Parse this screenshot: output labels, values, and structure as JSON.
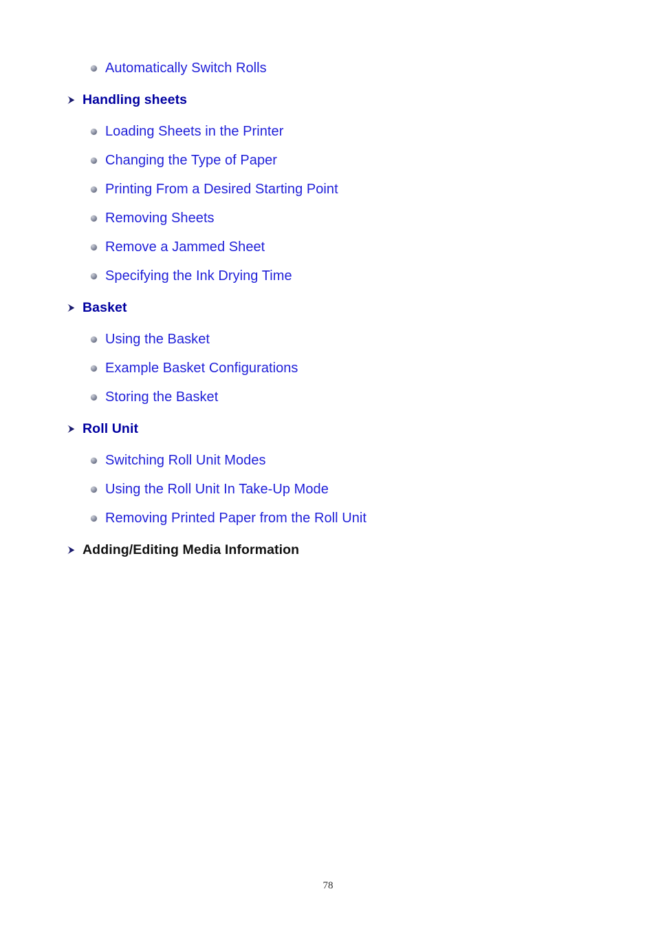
{
  "document": {
    "page_number": "78",
    "colors": {
      "link_text": "#1f1fd8",
      "heading_link": "#0000a0",
      "heading_plain": "#111111",
      "arrow_marker": "#1b1b6e",
      "bullet_marker": "#6e7489",
      "background": "#ffffff"
    }
  },
  "toc": {
    "rows": [
      {
        "kind": "item",
        "marker": "sphere-bullet-icon",
        "label": "Automatically Switch Rolls",
        "style": "link"
      },
      {
        "kind": "section",
        "marker": "arrow-right-icon",
        "label": "Handling sheets",
        "style": "link"
      },
      {
        "kind": "item",
        "marker": "sphere-bullet-icon",
        "label": "Loading Sheets in the Printer",
        "style": "link"
      },
      {
        "kind": "item",
        "marker": "sphere-bullet-icon",
        "label": "Changing the Type of Paper",
        "style": "link"
      },
      {
        "kind": "item",
        "marker": "sphere-bullet-icon",
        "label": "Printing From a Desired Starting Point",
        "style": "link"
      },
      {
        "kind": "item",
        "marker": "sphere-bullet-icon",
        "label": "Removing Sheets",
        "style": "link"
      },
      {
        "kind": "item",
        "marker": "sphere-bullet-icon",
        "label": "Remove a Jammed Sheet",
        "style": "link"
      },
      {
        "kind": "item",
        "marker": "sphere-bullet-icon",
        "label": "Specifying the Ink Drying Time",
        "style": "link"
      },
      {
        "kind": "section",
        "marker": "arrow-right-icon",
        "label": "Basket",
        "style": "link"
      },
      {
        "kind": "item",
        "marker": "sphere-bullet-icon",
        "label": "Using the Basket",
        "style": "link"
      },
      {
        "kind": "item",
        "marker": "sphere-bullet-icon",
        "label": "Example Basket Configurations",
        "style": "link"
      },
      {
        "kind": "item",
        "marker": "sphere-bullet-icon",
        "label": "Storing the Basket",
        "style": "link"
      },
      {
        "kind": "section",
        "marker": "arrow-right-icon",
        "label": "Roll Unit",
        "style": "link"
      },
      {
        "kind": "item",
        "marker": "sphere-bullet-icon",
        "label": "Switching Roll Unit Modes",
        "style": "link"
      },
      {
        "kind": "item",
        "marker": "sphere-bullet-icon",
        "label": "Using the Roll Unit In Take-Up Mode",
        "style": "link"
      },
      {
        "kind": "item",
        "marker": "sphere-bullet-icon",
        "label": "Removing Printed Paper from the Roll Unit",
        "style": "link"
      },
      {
        "kind": "section",
        "marker": "arrow-right-icon",
        "label": "Adding/Editing Media Information",
        "style": "plain"
      }
    ]
  }
}
